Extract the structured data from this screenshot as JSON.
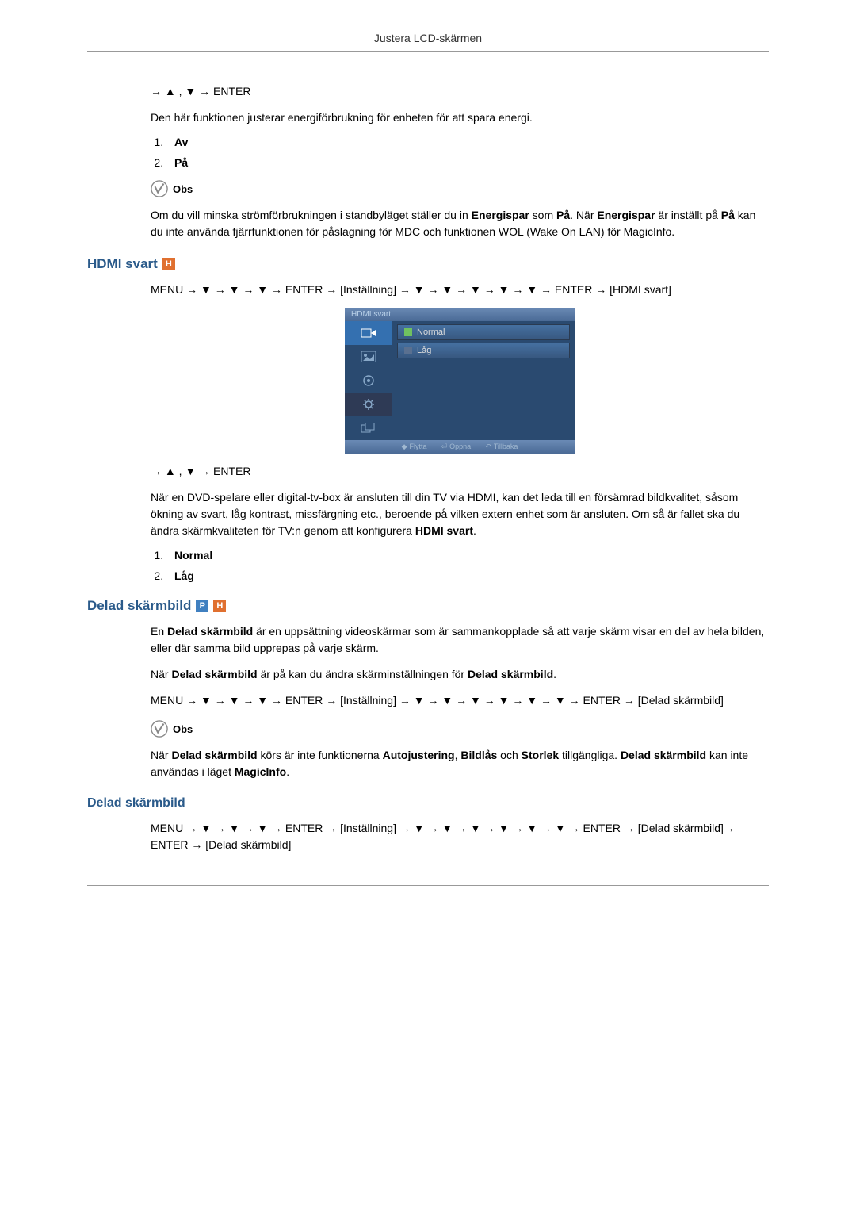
{
  "header": {
    "title": "Justera LCD-skärmen"
  },
  "section1": {
    "nav": "→ ▲ , ▼ → ENTER",
    "intro": "Den här funktionen justerar energiförbrukning för enheten för att spara energi.",
    "items": [
      "Av",
      "På"
    ],
    "note_label": "Obs",
    "note_text": "Om du vill minska strömförbrukningen i standbyläget ställer du in Energispar som På. När Energispar är inställt på På kan du inte använda fjärrfunktionen för påslagning för MDC och funktionen WOL (Wake On LAN) för MagicInfo."
  },
  "section2": {
    "title": "HDMI svart",
    "nav": "MENU → ▼ → ▼ → ▼ → ENTER → [Inställning] → ▼ → ▼ → ▼ → ▼ → ▼ → ENTER → [HDMI svart]",
    "menu": {
      "titlebar": "HDMI svart",
      "options": [
        "Normal",
        "Låg"
      ],
      "footer": {
        "move": "Flytta",
        "open": "Öppna",
        "back": "Tillbaka"
      }
    },
    "nav2": "→ ▲ , ▼ → ENTER",
    "para": "När en DVD-spelare eller digital-tv-box är ansluten till din TV via HDMI, kan det leda till en försämrad bildkvalitet, såsom ökning av svart, låg kontrast, missfärgning etc., beroende på vilken extern enhet som är ansluten. Om så är fallet ska du ändra skärmkvaliteten för TV:n genom att konfigurera HDMI svart.",
    "items": [
      "Normal",
      "Låg"
    ]
  },
  "section3": {
    "title": "Delad skärmbild",
    "para1": "En Delad skärmbild är en uppsättning videoskärmar som är sammankopplade så att varje skärm visar en del av hela bilden, eller där samma bild upprepas på varje skärm.",
    "para2": "När Delad skärmbild är på kan du ändra skärminställningen för Delad skärmbild.",
    "nav": "MENU → ▼ → ▼ → ▼ → ENTER → [Inställning] → ▼ → ▼ → ▼ → ▼ → ▼ → ▼ → ENTER → [Delad skärmbild]",
    "note_label": "Obs",
    "note_text": "När Delad skärmbild körs är inte funktionerna Autojustering, Bildlås  och Storlek tillgängliga. Delad skärmbild kan inte användas i läget MagicInfo."
  },
  "section4": {
    "title": "Delad skärmbild",
    "nav": "MENU → ▼ → ▼ → ▼ → ENTER → [Inställning] → ▼ → ▼ → ▼ → ▼ → ▼ → ▼ → ENTER → [Delad skärmbild]→ ENTER → [Delad skärmbild]"
  }
}
